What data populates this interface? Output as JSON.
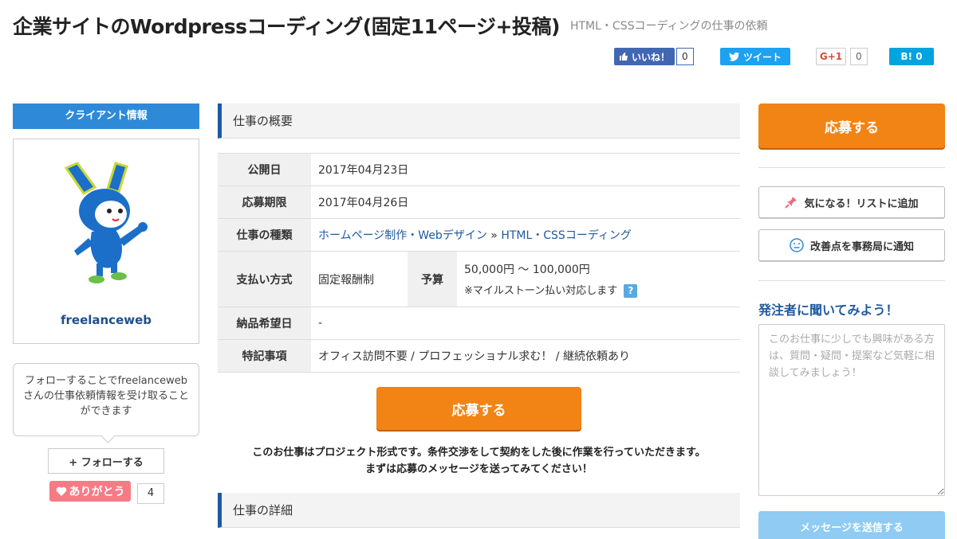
{
  "header": {
    "title": "企業サイトのWordpressコーディング(固定11ページ+投稿)",
    "subtitle": "HTML・CSSコーディングの仕事の依頼"
  },
  "social": {
    "facebook_label": "いいね！",
    "facebook_count": "0",
    "twitter_label": "ツイート",
    "google_label": "G+1",
    "google_count": "0",
    "hatena_label": "B! 0"
  },
  "client": {
    "heading": "クライアント情報",
    "name": "freelanceweb",
    "follow_note": "フォローすることでfreelancewebさんの仕事依頼情報を受け取ることができます",
    "follow_label": "+ フォローする",
    "thanks_label": "ありがとう",
    "thanks_count": "4"
  },
  "overview": {
    "heading": "仕事の概要",
    "rows": {
      "published_label": "公開日",
      "published_value": "2017年04月23日",
      "deadline_label": "応募期限",
      "deadline_value": "2017年04月26日",
      "type_label": "仕事の種類",
      "type_link1": "ホームページ制作・Webデザイン",
      "type_sep": "»",
      "type_link2": "HTML・CSSコーディング",
      "payment_label": "支払い方式",
      "payment_value": "固定報酬制",
      "budget_label": "予算",
      "budget_value": "50,000円 〜 100,000円",
      "budget_note": "※マイルストーン払い対応します",
      "delivery_label": "納品希望日",
      "delivery_value": "-",
      "notes_label": "特記事項",
      "notes_value": "オフィス訪問不要 / プロフェッショナル求む！ / 継続依頼あり"
    }
  },
  "apply_label": "応募する",
  "project_note_line1": "このお仕事はプロジェクト形式です。条件交渉をして契約をした後に作業を行っていただきます。",
  "project_note_line2": "まずは応募のメッセージを送ってみてください！",
  "detail_heading": "仕事の詳細",
  "sidebar": {
    "apply_label": "応募する",
    "favorite_label": "気になる！リストに追加",
    "report_label": "改善点を事務局に通知",
    "ask_title": "発注者に聞いてみよう！",
    "ask_placeholder": "このお仕事に少しでも興味がある方は、質問・疑問・提案など気軽に相談してみましょう！",
    "send_label": "メッセージを送信する"
  },
  "colors": {
    "accent_orange": "#f28415",
    "brand_blue": "#2e8ad8",
    "link_blue": "#1e5aa0"
  }
}
